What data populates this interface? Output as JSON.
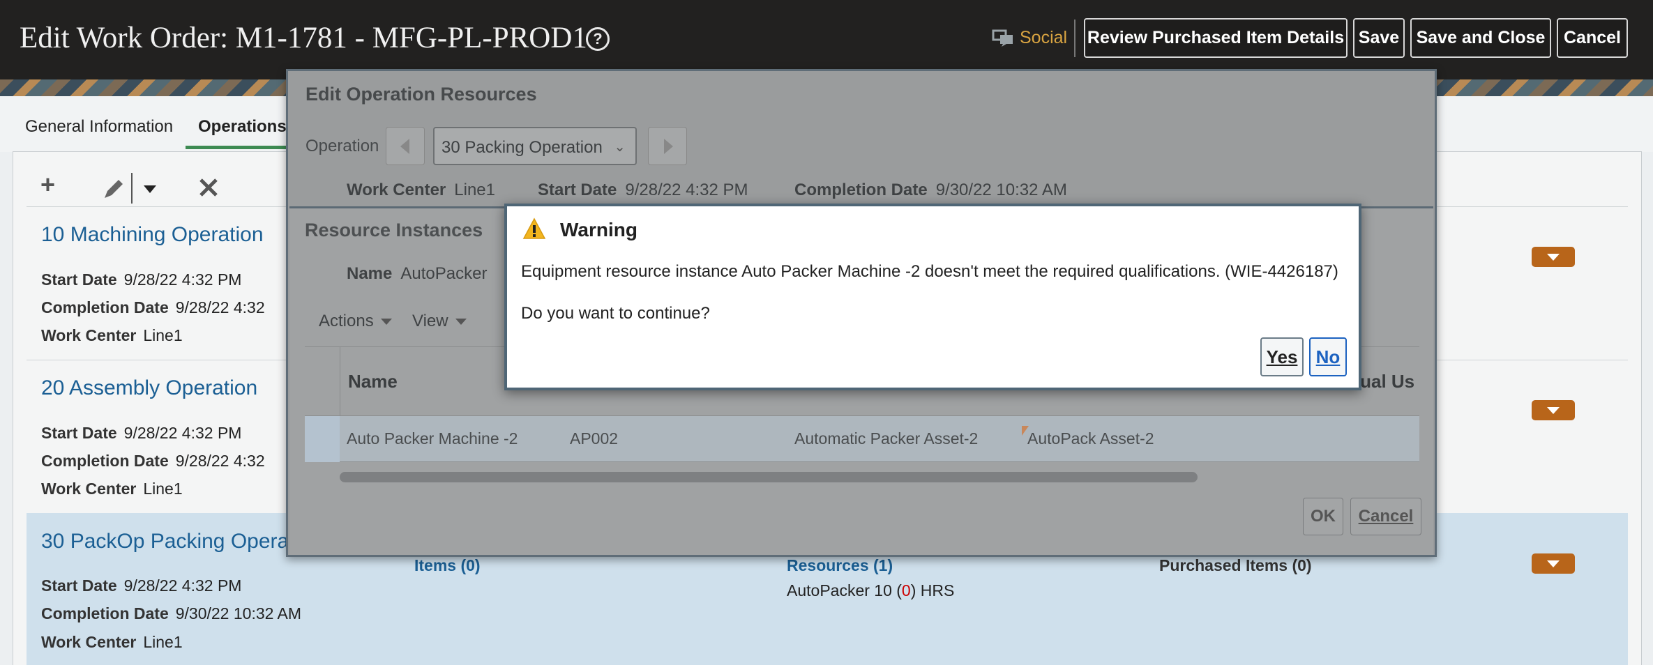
{
  "header": {
    "title": "Edit Work Order: M1-1781 - MFG-PL-PROD1",
    "social_label": "Social",
    "buttons": {
      "review": "Review Purchased Item Details",
      "save": "Save",
      "save_close": "Save and Close",
      "cancel": "Cancel"
    }
  },
  "tabs": [
    "General Information",
    "Operations"
  ],
  "operations": [
    {
      "title": "10 Machining Operation",
      "start_label": "Start Date",
      "start": "9/28/22 4:32 PM",
      "completion_label": "Completion Date",
      "completion": "9/28/22 4:32",
      "wc_label": "Work Center",
      "wc": "Line1"
    },
    {
      "title": "20 Assembly Operation",
      "start_label": "Start Date",
      "start": "9/28/22 4:32 PM",
      "completion_label": "Completion Date",
      "completion": "9/28/22 4:32",
      "wc_label": "Work Center",
      "wc": "Line1"
    },
    {
      "title": "30 PackOp Packing Opera",
      "start_label": "Start Date",
      "start": "9/28/22 4:32 PM",
      "completion_label": "Completion Date",
      "completion": "9/30/22 10:32 AM",
      "wc_label": "Work Center",
      "wc": "Line1",
      "items": "Items (0)",
      "resources": "Resources (1)",
      "resource_line_pre": "AutoPacker  10  (",
      "resource_line_zero": "0",
      "resource_line_post": ")  HRS",
      "purchased": "Purchased Items (0)"
    }
  ],
  "edit_op_resources": {
    "title": "Edit Operation Resources",
    "operation_label": "Operation",
    "operation_value": "30 Packing Operation",
    "work_center_label": "Work Center",
    "work_center": "Line1",
    "start_label": "Start Date",
    "start": "9/28/22 4:32 PM",
    "completion_label": "Completion Date",
    "completion": "9/30/22 10:32 AM",
    "resource_instances": {
      "title": "Resource Instances",
      "name_label": "Name",
      "name": "AutoPacker",
      "actions": "Actions",
      "view": "View",
      "col_name": "Name",
      "col_actual": "ctual Us",
      "row": [
        "Auto Packer Machine -2",
        "AP002",
        "Automatic Packer Asset-2",
        "AutoPack Asset-2"
      ]
    },
    "ok": "OK",
    "cancel": "Cancel"
  },
  "warning": {
    "title": "Warning",
    "message": "Equipment resource instance Auto Packer Machine -2 doesn't meet the required qualifications. (WIE-4426187)",
    "question": "Do you want to continue?",
    "yes": "Yes",
    "no": "No"
  }
}
